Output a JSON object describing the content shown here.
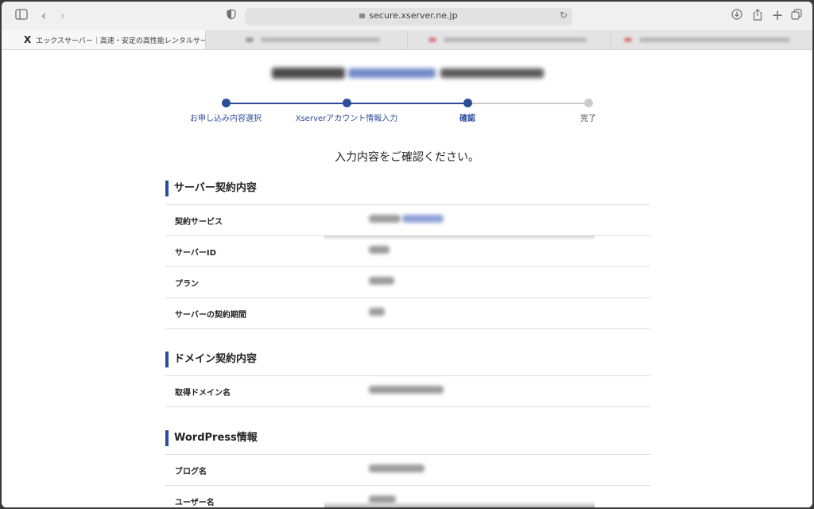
{
  "browser": {
    "url": "secure.xserver.ne.jp",
    "tabs": [
      {
        "favicon": "X",
        "title": "エックスサーバー｜高速・安定の高性能レンタルサーバー",
        "active": true
      },
      {
        "title": "",
        "active": false
      },
      {
        "title": "",
        "active": false
      },
      {
        "title": "",
        "active": false
      }
    ]
  },
  "stepper": {
    "steps": [
      {
        "label": "お申し込み内容選択",
        "state": "done"
      },
      {
        "label": "Xserverアカウント情報入力",
        "state": "done"
      },
      {
        "label": "確認",
        "state": "current"
      },
      {
        "label": "完了",
        "state": "todo"
      }
    ],
    "active_color": "#2d4c99",
    "inactive_color": "#cccccc"
  },
  "confirm_message": "入力内容をご確認ください。",
  "sections": {
    "server": {
      "title": "サーバー契約内容",
      "rows": [
        "契約サービス",
        "サーバーID",
        "プラン",
        "サーバーの契約期間"
      ]
    },
    "domain": {
      "title": "ドメイン契約内容",
      "rows": [
        "取得ドメイン名"
      ]
    },
    "wordpress": {
      "title": "WordPress情報",
      "rows": [
        "ブログ名",
        "ユーザー名"
      ]
    }
  }
}
